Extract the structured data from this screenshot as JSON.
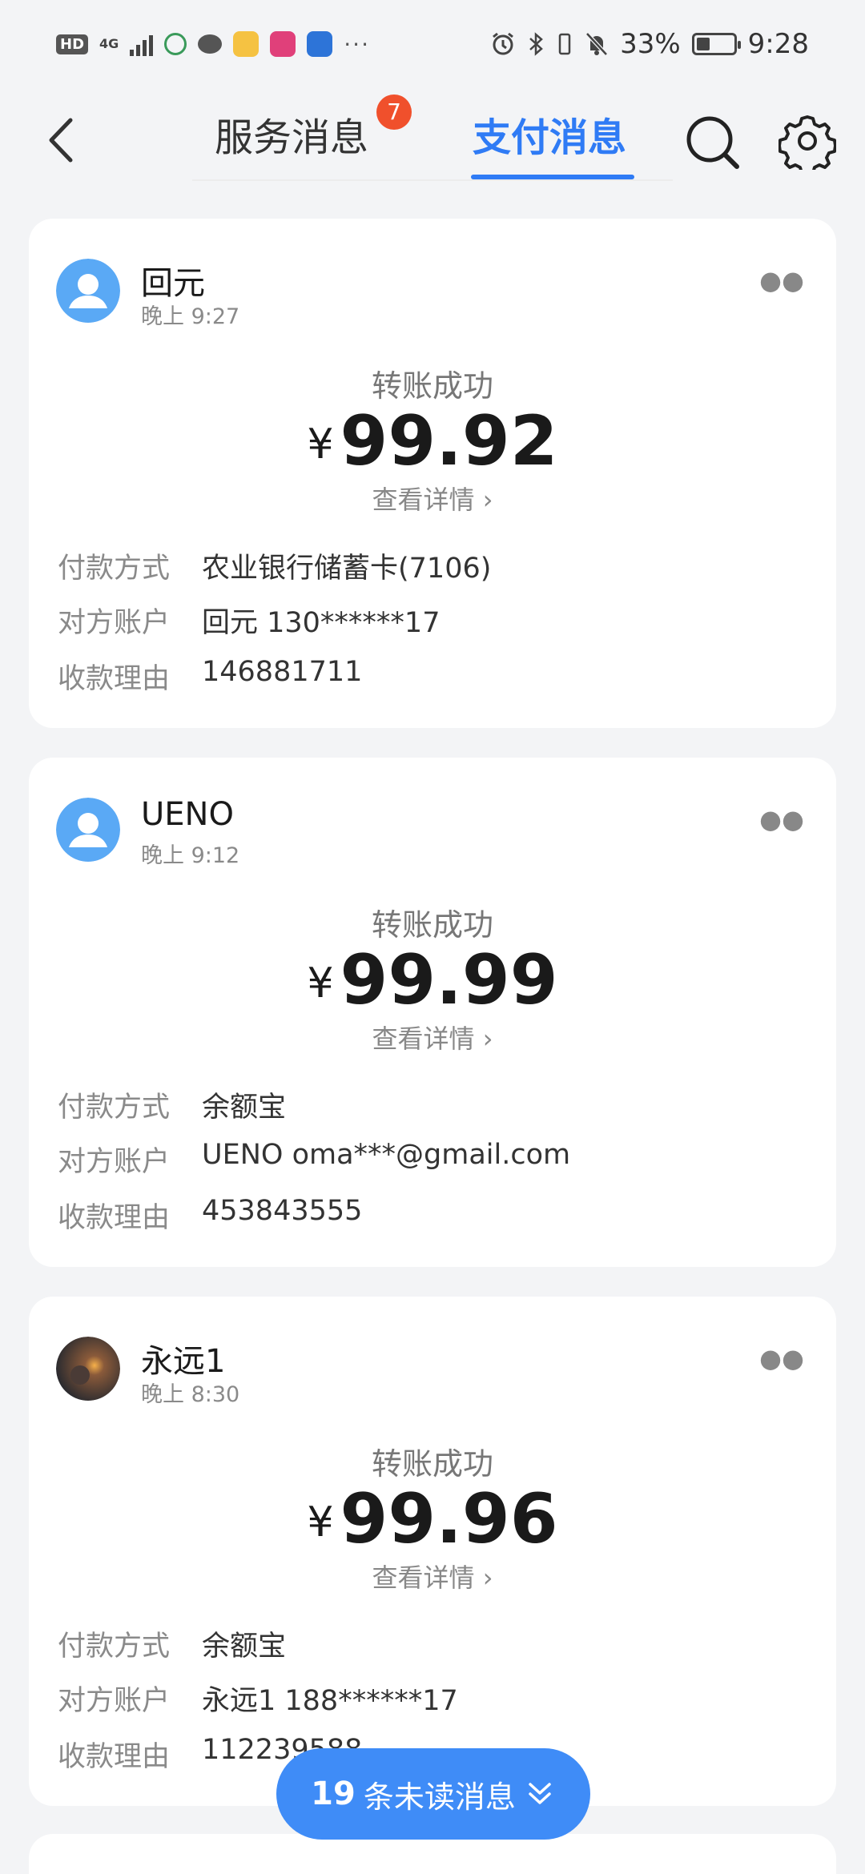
{
  "status_bar": {
    "hd": "HD",
    "network": "4G",
    "battery_percent": "33%",
    "battery_level": 0.33,
    "time": "9:28",
    "more": "···"
  },
  "header": {
    "tab_service": "服务消息",
    "tab_payment": "支付消息",
    "service_badge": "7",
    "active_tab": "支付消息"
  },
  "labels": {
    "method": "付款方式",
    "account": "对方账户",
    "reason": "收款理由",
    "status": "转账成功",
    "detail": "查看详情",
    "currency": "¥"
  },
  "messages": [
    {
      "name": "回元",
      "time": "晚上 9:27",
      "amount": "99.92",
      "method": "农业银行储蓄卡(7106)",
      "account": "回元 130******17",
      "reason": "146881711"
    },
    {
      "name": "UENO",
      "time": "晚上 9:12",
      "amount": "99.99",
      "method": "余额宝",
      "account": "UENO oma***@gmail.com",
      "reason": "453843555"
    },
    {
      "name": "永远1",
      "time": "晚上 8:30",
      "amount": "99.96",
      "method": "余额宝",
      "account": "永远1 188******17",
      "reason": "112239588"
    }
  ],
  "unread": {
    "count": "19",
    "text": "条未读消息"
  },
  "colors": {
    "accent": "#2f7bf5",
    "badge": "#f0502c",
    "pill": "#3f8cf7"
  }
}
